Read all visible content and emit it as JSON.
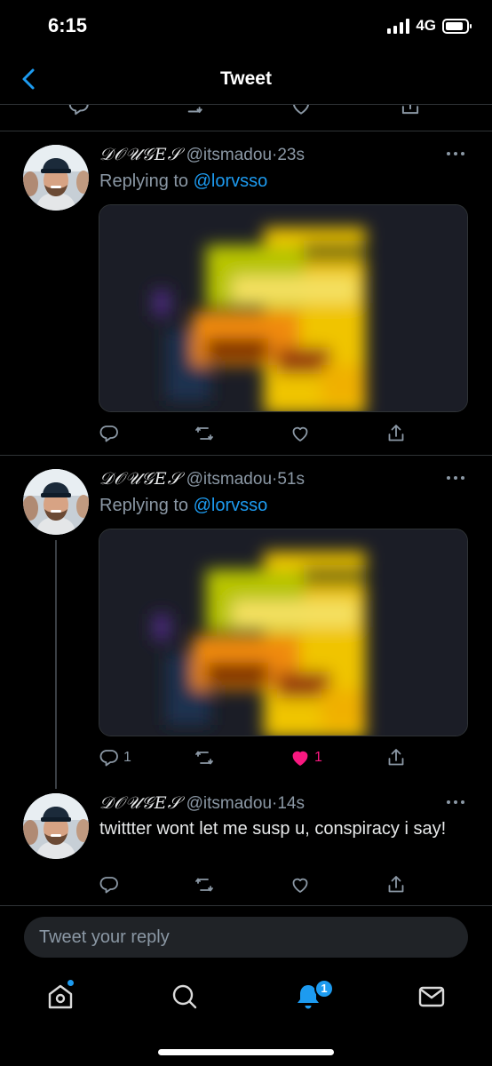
{
  "status_bar": {
    "time": "6:15",
    "network": "4G"
  },
  "header": {
    "title": "Tweet"
  },
  "tweets": [
    {
      "display_name": "𝒟𝒪𝒰𝒢𝐸𝒮",
      "handle": "@itsmadou",
      "separator": "·",
      "time": "23s",
      "replying_prefix": "Replying to",
      "replying_to": "@lorvsso",
      "reply_count": "",
      "like_count": "",
      "liked": false
    },
    {
      "display_name": "𝒟𝒪𝒰𝒢𝐸𝒮",
      "handle": "@itsmadou",
      "separator": "·",
      "time": "51s",
      "replying_prefix": "Replying to",
      "replying_to": "@lorvsso",
      "reply_count": "1",
      "like_count": "1",
      "liked": true
    },
    {
      "display_name": "𝒟𝒪𝒰𝒢𝐸𝒮",
      "handle": "@itsmadou",
      "separator": "·",
      "time": "14s",
      "text": "twittter wont let me susp u, conspiracy i say!",
      "reply_count": "",
      "like_count": "",
      "liked": false
    }
  ],
  "reply_bar": {
    "placeholder": "Tweet your reply"
  },
  "tab_bar": {
    "notification_count": "1"
  },
  "colors": {
    "accent": "#1d9bf0",
    "like": "#f91880",
    "muted": "#8b98a5",
    "background": "#000000"
  }
}
